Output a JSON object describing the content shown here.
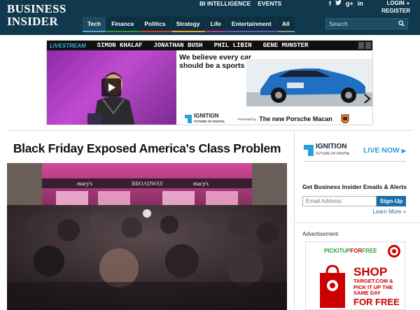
{
  "header": {
    "logo_line1": "BUSINESS",
    "logo_line2": "INSIDER",
    "top_links": [
      "BI INTELLIGENCE",
      "EVENTS"
    ],
    "social_icons": [
      "facebook-icon",
      "twitter-icon",
      "google-plus-icon",
      "linkedin-icon"
    ],
    "social_glyphs": [
      "f",
      "t",
      "g+",
      "in"
    ],
    "login_label": "LOGIN",
    "register_label": "REGISTER",
    "nav": [
      "Tech",
      "Finance",
      "Politics",
      "Strategy",
      "Life",
      "Entertainment",
      "All"
    ],
    "search_placeholder": "Search"
  },
  "top_ad": {
    "strip_label": "LIVESTREAM",
    "speakers": [
      "SIMON KHALAF",
      "JONATHAN BUSH",
      "PHIL LIBIN",
      "GENE MUNSTER"
    ],
    "headline": "We believe every car should be a sports car.",
    "ignition_title": "IGNITION",
    "ignition_sub": "FUTURE OF DIGITAL",
    "presented_by": "Presented by",
    "sponsor": "The new Porsche Macan"
  },
  "article": {
    "headline": "Black Friday Exposed America's Class Problem",
    "store_sign_1": "macy's",
    "store_sign_2": "BROADWAY",
    "store_sign_3": "macy's"
  },
  "sidebar": {
    "ignition_title": "IGNITION",
    "ignition_sub": "FUTURE OF DIGITAL",
    "live_now": "LIVE NOW",
    "newsletter_title": "Get Business Insider Emails & Alerts",
    "email_placeholder": "Email Address",
    "signup_label": "Sign-Up",
    "learn_more": "Learn More »",
    "advertisement_label": "Advertisement",
    "target_top_1": "PICKITUP",
    "target_top_2": "FOR",
    "target_top_3": "FREE",
    "target_shop": "SHOP",
    "target_sub": "TARGET.COM & PICK IT UP THE SAME DAY",
    "target_free": "FOR FREE"
  },
  "colors": {
    "header_bg": "#10394e",
    "link_blue": "#1a6fa8",
    "target_red": "#cc0000",
    "live_blue": "#2a9fd8"
  }
}
